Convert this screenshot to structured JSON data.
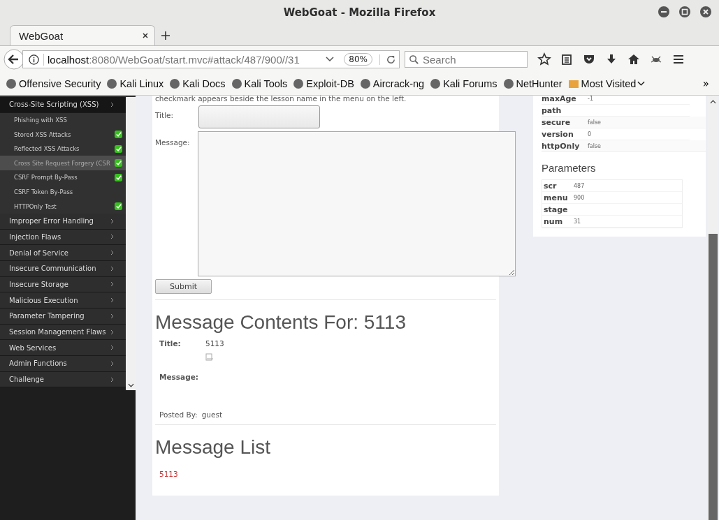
{
  "window": {
    "title": "WebGoat - Mozilla Firefox"
  },
  "tabs": [
    {
      "label": "WebGoat",
      "selected": true
    }
  ],
  "address": {
    "host": "localhost",
    "path": ":8080/WebGoat/start.mvc#attack/487/900//31",
    "zoom": "80%"
  },
  "search": {
    "placeholder": "Search"
  },
  "bookmarks": [
    "Offensive Security",
    "Kali Linux",
    "Kali Docs",
    "Kali Tools",
    "Exploit-DB",
    "Aircrack-ng",
    "Kali Forums",
    "NetHunter",
    "Most Visited"
  ],
  "bookmarks_overflow": "»",
  "sidebar": {
    "items": [
      {
        "label": "Cross-Site Scripting (XSS)",
        "expanded": true,
        "children": [
          {
            "label": "Phishing with XSS",
            "completed": false,
            "selected": false
          },
          {
            "label": "Stored XSS Attacks",
            "completed": true,
            "selected": false
          },
          {
            "label": "Reflected XSS Attacks",
            "completed": true,
            "selected": false
          },
          {
            "label": "Cross Site Request Forgery (CSR",
            "completed": true,
            "selected": true
          },
          {
            "label": "CSRF Prompt By-Pass",
            "completed": true,
            "selected": false
          },
          {
            "label": "CSRF Token By-Pass",
            "completed": false,
            "selected": false
          },
          {
            "label": "HTTPOnly Test",
            "completed": true,
            "selected": false
          }
        ]
      },
      {
        "label": "Improper Error Handling",
        "expanded": false
      },
      {
        "label": "Injection Flaws",
        "expanded": false
      },
      {
        "label": "Denial of Service",
        "expanded": false
      },
      {
        "label": "Insecure Communication",
        "expanded": false
      },
      {
        "label": "Insecure Storage",
        "expanded": false
      },
      {
        "label": "Malicious Execution",
        "expanded": false
      },
      {
        "label": "Parameter Tampering",
        "expanded": false
      },
      {
        "label": "Session Management Flaws",
        "expanded": false
      },
      {
        "label": "Web Services",
        "expanded": false
      },
      {
        "label": "Admin Functions",
        "expanded": false
      },
      {
        "label": "Challenge",
        "expanded": false
      }
    ]
  },
  "lesson": {
    "intro": "checkmark appears beside the lesson name in the menu on the left.",
    "form": {
      "title_label": "Title:",
      "message_label": "Message:",
      "submit": "Submit"
    },
    "contents": {
      "heading": "Message Contents For: 5113",
      "title_label": "Title:",
      "title_value": "5113",
      "message_label": "Message:",
      "posted_label": "Posted By:",
      "posted_value": "guest"
    },
    "list": {
      "heading": "Message List",
      "links": [
        "5113"
      ]
    }
  },
  "cookie": {
    "rows": [
      {
        "name": "maxAge",
        "value": "-1"
      },
      {
        "name": "path",
        "value": ""
      },
      {
        "name": "secure",
        "value": "false"
      },
      {
        "name": "version",
        "value": "0"
      },
      {
        "name": "httpOnly",
        "value": "false"
      }
    ]
  },
  "parameters": {
    "heading": "Parameters",
    "rows": [
      {
        "name": "scr",
        "value": "487"
      },
      {
        "name": "menu",
        "value": "900"
      },
      {
        "name": "stage",
        "value": ""
      },
      {
        "name": "num",
        "value": "31"
      }
    ]
  }
}
